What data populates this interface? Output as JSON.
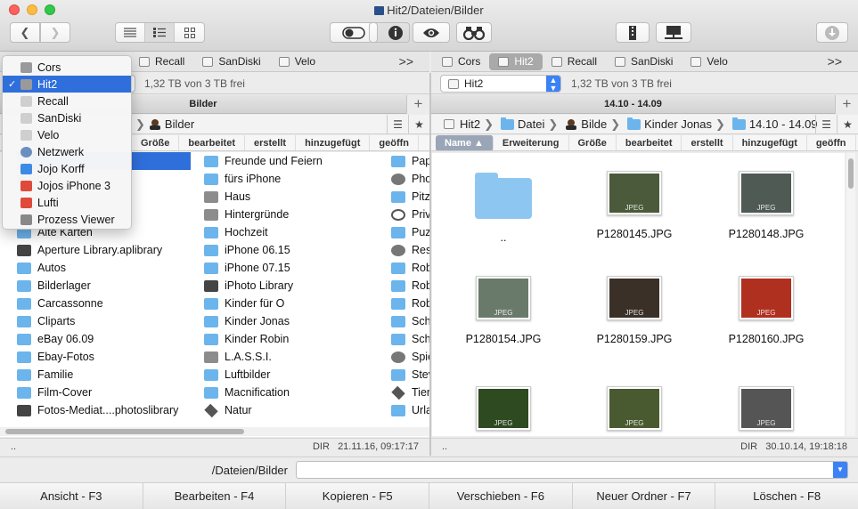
{
  "window": {
    "title": "Hit2/Dateien/Bilder"
  },
  "toolbar": {
    "back_icon": "chevron-left-icon",
    "forward_icon": "chevron-right-icon",
    "view_modes": [
      "list-icon",
      "detail-icon",
      "grid-icon"
    ],
    "buttons": [
      "toggle-icon",
      "info-icon",
      "eye-icon",
      "binoculars-icon"
    ],
    "right_buttons": [
      "zip-icon",
      "network-icon",
      "download-icon"
    ]
  },
  "drives_left": [
    "Recall",
    "SanDiski",
    "Velo"
  ],
  "drives_right": [
    "Cors",
    "Hit2",
    "Recall",
    "SanDiski",
    "Velo"
  ],
  "drives_right_active": "Hit2",
  "more_label": ">>",
  "left": {
    "free_space": "1,32 TB von 3 TB frei",
    "header": "Bilder",
    "path": [
      {
        "label": "Bilder"
      }
    ],
    "columns": [
      "Größe",
      "bearbeitet",
      "erstellt",
      "hinzugefügt",
      "geöffn"
    ],
    "col1": [
      {
        "name": "",
        "icon": "folder",
        "selected": true
      },
      {
        "name": "log",
        "icon": "doc"
      },
      {
        "name": "",
        "icon": "none"
      },
      {
        "name": "",
        "icon": "none"
      },
      {
        "name": "Alte Karten",
        "icon": "folder"
      },
      {
        "name": "Aperture Library.aplibrary",
        "icon": "lib"
      },
      {
        "name": "Autos",
        "icon": "folder"
      },
      {
        "name": "Bilderlager",
        "icon": "folder"
      },
      {
        "name": "Carcassonne",
        "icon": "folder"
      },
      {
        "name": "Cliparts",
        "icon": "folder"
      },
      {
        "name": "eBay 06.09",
        "icon": "folder"
      },
      {
        "name": "Ebay-Fotos",
        "icon": "folder"
      },
      {
        "name": "Familie",
        "icon": "folder"
      },
      {
        "name": "Film-Cover",
        "icon": "folder"
      },
      {
        "name": "Fotos-Mediat....photoslibrary",
        "icon": "lib"
      }
    ],
    "col2": [
      {
        "name": "Freunde und Feiern",
        "icon": "folder"
      },
      {
        "name": "fürs iPhone",
        "icon": "folder"
      },
      {
        "name": "Haus",
        "icon": "doc"
      },
      {
        "name": "Hintergründe",
        "icon": "doc"
      },
      {
        "name": "Hochzeit",
        "icon": "folder"
      },
      {
        "name": "iPhone 06.15",
        "icon": "folder"
      },
      {
        "name": "iPhone 07.15",
        "icon": "folder"
      },
      {
        "name": "iPhoto Library",
        "icon": "lib"
      },
      {
        "name": "Kinder für O",
        "icon": "folder"
      },
      {
        "name": "Kinder Jonas",
        "icon": "folder"
      },
      {
        "name": "Kinder Robin",
        "icon": "folder"
      },
      {
        "name": "L.A.S.S.I.",
        "icon": "doc"
      },
      {
        "name": "Luftbilder",
        "icon": "folder"
      },
      {
        "name": "Macnification",
        "icon": "folder"
      },
      {
        "name": "Natur",
        "icon": "gem"
      }
    ],
    "col3": [
      {
        "name": "Pap",
        "icon": "folder"
      },
      {
        "name": "Pho",
        "icon": "gear"
      },
      {
        "name": "Pitz",
        "icon": "folder"
      },
      {
        "name": "Priv",
        "icon": "heart"
      },
      {
        "name": "Puz",
        "icon": "folder"
      },
      {
        "name": "Res",
        "icon": "gear"
      },
      {
        "name": "Rob",
        "icon": "folder"
      },
      {
        "name": "Rob",
        "icon": "folder"
      },
      {
        "name": "Rob",
        "icon": "folder"
      },
      {
        "name": "Sch",
        "icon": "folder"
      },
      {
        "name": "Sch",
        "icon": "folder"
      },
      {
        "name": "Spie",
        "icon": "gear"
      },
      {
        "name": "Stev",
        "icon": "folder"
      },
      {
        "name": "Tier",
        "icon": "gem"
      },
      {
        "name": "Urla",
        "icon": "folder"
      }
    ],
    "status_left": "..",
    "status_right": "DIR   21.11.16, 09:17:17"
  },
  "right": {
    "volume": "Hit2",
    "free_space": "1,32 TB von 3 TB frei",
    "header": "14.10 - 14.09",
    "path": [
      {
        "label": "Hit2",
        "icon": "drive"
      },
      {
        "label": "Datei",
        "icon": "folder"
      },
      {
        "label": "Bilde",
        "icon": "user"
      },
      {
        "label": "Kinder Jonas",
        "icon": "folder"
      },
      {
        "label": "14.10 - 14.09",
        "icon": "folder"
      }
    ],
    "columns": [
      "Name",
      "Erweiterung",
      "Größe",
      "bearbeitet",
      "erstellt",
      "hinzugefügt",
      "geöffn"
    ],
    "sorted_column": "Name",
    "sort_icon": "sort-ascending-icon",
    "thumbs": [
      {
        "label": "..",
        "type": "folder"
      },
      {
        "label": "P1280145.JPG",
        "type": "image",
        "color": "#4a5a3a"
      },
      {
        "label": "P1280148.JPG",
        "type": "image",
        "color": "#505a55"
      },
      {
        "label": "P1280154.JPG",
        "type": "image",
        "color": "#6a7a6a"
      },
      {
        "label": "P1280159.JPG",
        "type": "image",
        "color": "#3a3028"
      },
      {
        "label": "P1280160.JPG",
        "type": "image",
        "color": "#b03020"
      },
      {
        "label": "",
        "type": "image",
        "color": "#2e4a20"
      },
      {
        "label": "",
        "type": "image",
        "color": "#4a5a30"
      },
      {
        "label": "",
        "type": "image",
        "color": "#555555"
      }
    ],
    "thumb_tag": "JPEG",
    "status_left": "..",
    "status_right": "DIR   30.10.14, 19:18:18"
  },
  "command": {
    "path_label": "/Dateien/Bilder",
    "value": ""
  },
  "fkeys": [
    "Ansicht - F3",
    "Bearbeiten - F4",
    "Kopieren - F5",
    "Verschieben - F6",
    "Neuer Ordner - F7",
    "Löschen - F8"
  ],
  "popup": {
    "items": [
      {
        "label": "Cors",
        "icon": "drive-icon",
        "color": "#9a9a9a"
      },
      {
        "label": "Hit2",
        "icon": "drive-icon",
        "color": "#9a9a9a",
        "selected": true
      },
      {
        "label": "Recall",
        "icon": "drive-icon",
        "color": "#cfcfcf"
      },
      {
        "label": "SanDiski",
        "icon": "drive-icon",
        "color": "#cfcfcf"
      },
      {
        "label": "Velo",
        "icon": "drive-icon",
        "color": "#cfcfcf"
      },
      {
        "label": "Netzwerk",
        "icon": "globe-icon",
        "color": "#6a8fbf"
      },
      {
        "label": "Jojo Korff",
        "icon": "dropbox-icon",
        "color": "#3d8ae6"
      },
      {
        "label": "Jojos iPhone 3",
        "icon": "phone-icon",
        "color": "#e04a3a"
      },
      {
        "label": "Lufti",
        "icon": "phone-icon",
        "color": "#e04a3a"
      },
      {
        "label": "Prozess Viewer",
        "icon": "process-icon",
        "color": "#888888"
      }
    ],
    "check": "✓"
  }
}
